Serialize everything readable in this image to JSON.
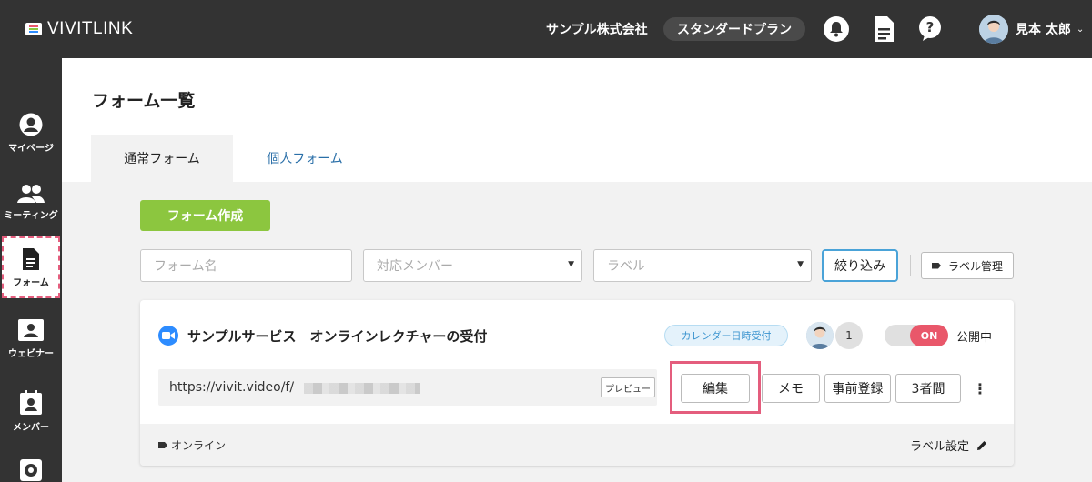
{
  "app": {
    "logo_text": "VIVITLINK"
  },
  "header": {
    "company": "サンプル株式会社",
    "plan": "スタンダードプラン",
    "username": "見本 太郎",
    "icons": [
      "bell-icon",
      "document-icon",
      "help-icon"
    ]
  },
  "sidebar": {
    "items": [
      {
        "label": "マイページ",
        "icon": "user-circle-icon"
      },
      {
        "label": "ミーティング",
        "icon": "people-icon"
      },
      {
        "label": "フォーム",
        "icon": "document-icon",
        "active": true
      },
      {
        "label": "ウェビナー",
        "icon": "webinar-icon"
      },
      {
        "label": "メンバー",
        "icon": "member-icon"
      },
      {
        "label": "",
        "icon": "gear-icon"
      }
    ]
  },
  "page": {
    "title": "フォーム一覧",
    "tabs": [
      {
        "label": "通常フォーム",
        "active": true
      },
      {
        "label": "個人フォーム",
        "active": false
      }
    ]
  },
  "toolbar": {
    "create_label": "フォーム作成",
    "form_name_placeholder": "フォーム名",
    "member_select": "対応メンバー",
    "label_select": "ラベル",
    "filter_label": "絞り込み",
    "label_manage": "ラベル管理"
  },
  "card": {
    "title": "サンプルサービス　オンラインレクチャーの受付",
    "badge": "カレンダー日時受付",
    "member_count": "1",
    "toggle_label": "ON",
    "status": "公開中",
    "url": "https://vivit.video/f/",
    "preview_label": "プレビュー",
    "actions": [
      "編集",
      "メモ",
      "事前登録",
      "3者間"
    ],
    "tag": "オンライン",
    "label_setting": "ラベル設定"
  },
  "colors": {
    "topbar": "#333333",
    "create_button": "#8cc63f",
    "toggle_on": "#e9576a",
    "highlight": "#e45d7d",
    "tab_link": "#2a6fa8"
  }
}
